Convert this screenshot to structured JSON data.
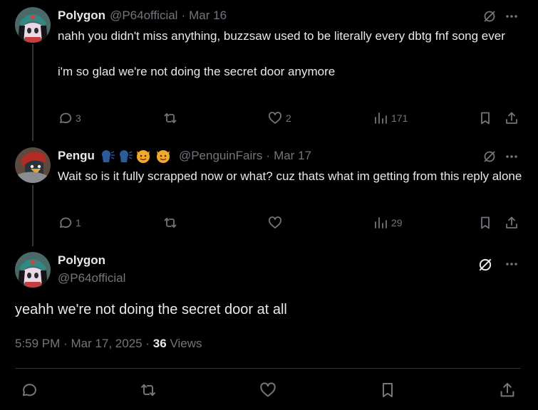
{
  "thread": [
    {
      "name": "Polygon",
      "handle": "@P64official",
      "date": "Mar 16",
      "text": "nahh you didn't miss anything, buzzsaw used to be literally every dbtg fnf song ever\n\ni'm so glad we're not doing the secret door anymore",
      "replies": "3",
      "reposts": "",
      "likes": "2",
      "views": "171"
    },
    {
      "name": "Pengu",
      "name_emojis": "🗣🗣😈😈",
      "handle": "@PenguinFairs",
      "date": "Mar 17",
      "text": "Wait so is it fully scrapped now or what? cuz thats what im getting from this reply alone",
      "replies": "1",
      "reposts": "",
      "likes": "",
      "views": "29"
    }
  ],
  "main_post": {
    "name": "Polygon",
    "handle": "@P64official",
    "text": "yeahh we're not doing the secret door at all",
    "time": "5:59 PM",
    "date": "Mar 17, 2025",
    "views_count": "36",
    "views_label": "Views"
  },
  "separator": "·",
  "icons": {
    "grok": "grok-icon",
    "more": "more-icon",
    "reply": "reply-icon",
    "repost": "repost-icon",
    "like": "like-icon",
    "views": "views-icon",
    "bookmark": "bookmark-icon",
    "share": "share-icon"
  },
  "colors": {
    "background": "#000000",
    "text": "#e7e9ea",
    "muted": "#71767b",
    "line": "#333639"
  }
}
